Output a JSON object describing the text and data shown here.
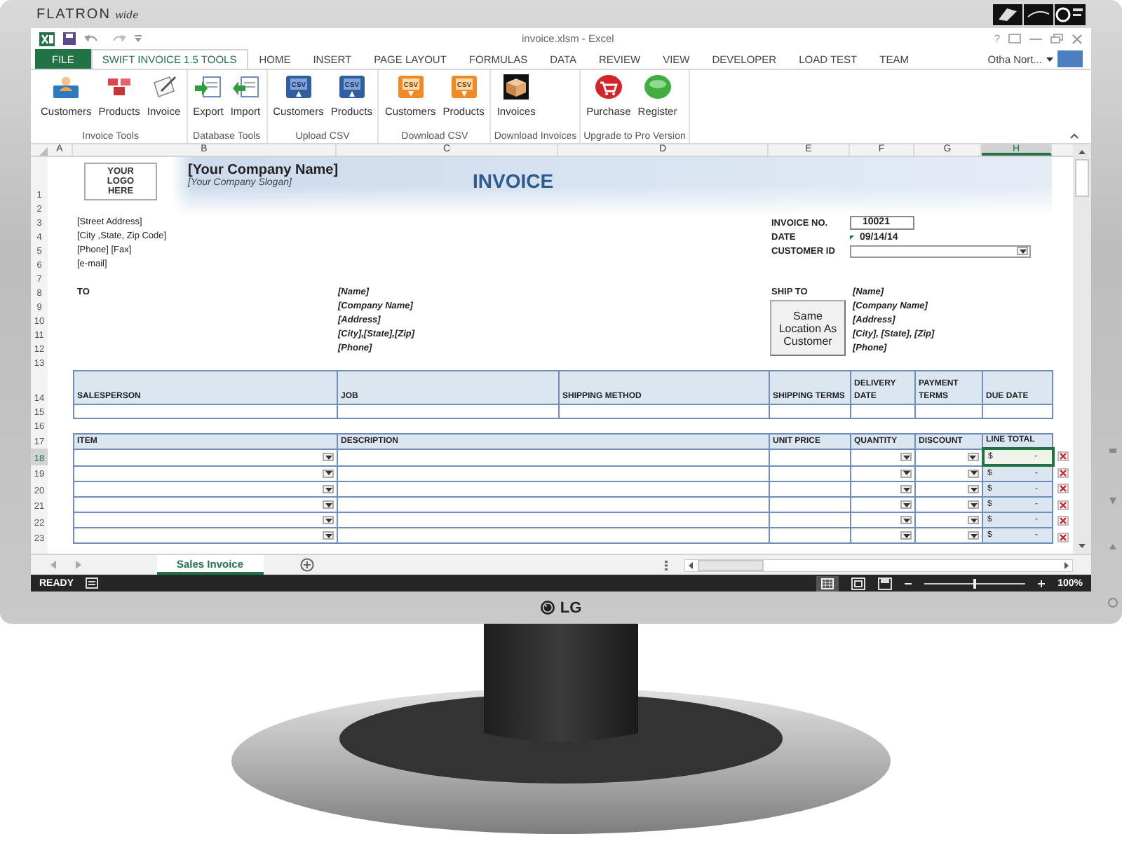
{
  "monitor": {
    "brand": "FLATRON",
    "brand_suffix": "wide",
    "logo": "LG"
  },
  "window": {
    "title": "invoice.xlsm - Excel",
    "help": "?"
  },
  "tabs": [
    {
      "label": "FILE",
      "kind": "file",
      "selected": false
    },
    {
      "label": "SWIFT INVOICE 1.5 TOOLS",
      "kind": "tab",
      "selected": true
    },
    {
      "label": "HOME",
      "kind": "tab",
      "selected": false
    },
    {
      "label": "INSERT",
      "kind": "tab",
      "selected": false
    },
    {
      "label": "PAGE LAYOUT",
      "kind": "tab",
      "selected": false
    },
    {
      "label": "FORMULAS",
      "kind": "tab",
      "selected": false
    },
    {
      "label": "DATA",
      "kind": "tab",
      "selected": false
    },
    {
      "label": "REVIEW",
      "kind": "tab",
      "selected": false
    },
    {
      "label": "VIEW",
      "kind": "tab",
      "selected": false
    },
    {
      "label": "DEVELOPER",
      "kind": "tab",
      "selected": false
    },
    {
      "label": "LOAD TEST",
      "kind": "tab",
      "selected": false
    },
    {
      "label": "TEAM",
      "kind": "tab",
      "selected": false
    }
  ],
  "account": {
    "name": "Otha Nort..."
  },
  "ribbon_groups": [
    {
      "label": "Invoice Tools",
      "buttons": [
        {
          "label": "Customers",
          "kind": "customers"
        },
        {
          "label": "Products",
          "kind": "products"
        },
        {
          "label": "Invoice",
          "kind": "invoice"
        }
      ]
    },
    {
      "label": "Database Tools",
      "buttons": [
        {
          "label": "Export",
          "kind": "export"
        },
        {
          "label": "Import",
          "kind": "import"
        }
      ]
    },
    {
      "label": "Upload CSV",
      "buttons": [
        {
          "label": "Customers",
          "kind": "csv-upload",
          "icon_text": "CSV"
        },
        {
          "label": "Products",
          "kind": "csv-upload",
          "icon_text": "CSV"
        }
      ]
    },
    {
      "label": "Download CSV",
      "buttons": [
        {
          "label": "Customers",
          "kind": "csv-download",
          "icon_text": "CSV"
        },
        {
          "label": "Products",
          "kind": "csv-download",
          "icon_text": "CSV"
        }
      ]
    },
    {
      "label": "Download Invoices",
      "buttons": [
        {
          "label": "Invoices",
          "kind": "box"
        }
      ]
    },
    {
      "label": "Upgrade to Pro Version",
      "buttons": [
        {
          "label": "Purchase",
          "kind": "purchase"
        },
        {
          "label": "Register",
          "kind": "register"
        }
      ]
    }
  ],
  "columns": [
    {
      "label": "A",
      "selected": false
    },
    {
      "label": "B",
      "selected": false
    },
    {
      "label": "C",
      "selected": false
    },
    {
      "label": "D",
      "selected": false
    },
    {
      "label": "E",
      "selected": false
    },
    {
      "label": "F",
      "selected": false
    },
    {
      "label": "G",
      "selected": false
    },
    {
      "label": "H",
      "selected": true
    }
  ],
  "rows": [
    {
      "label": "1",
      "selected": false
    },
    {
      "label": "2",
      "selected": false
    },
    {
      "label": "3",
      "selected": false
    },
    {
      "label": "4",
      "selected": false
    },
    {
      "label": "5",
      "selected": false
    },
    {
      "label": "6",
      "selected": false
    },
    {
      "label": "7",
      "selected": false
    },
    {
      "label": "8",
      "selected": false
    },
    {
      "label": "9",
      "selected": false
    },
    {
      "label": "10",
      "selected": false
    },
    {
      "label": "11",
      "selected": false
    },
    {
      "label": "12",
      "selected": false
    },
    {
      "label": "13",
      "selected": false
    },
    {
      "label": "14",
      "selected": false
    },
    {
      "label": "15",
      "selected": false
    },
    {
      "label": "16",
      "selected": false
    },
    {
      "label": "17",
      "selected": false
    },
    {
      "label": "18",
      "selected": true
    },
    {
      "label": "19",
      "selected": false
    },
    {
      "label": "20",
      "selected": false
    },
    {
      "label": "21",
      "selected": false
    },
    {
      "label": "22",
      "selected": false
    },
    {
      "label": "23",
      "selected": false
    }
  ],
  "header": {
    "logo_text": "YOUR LOGO HERE",
    "company_name": "[Your Company Name]",
    "slogan": "[Your Company Slogan]",
    "title": "INVOICE"
  },
  "from_address": [
    "[Street Address]",
    "[City ,State, Zip Code]",
    "[Phone] [Fax]",
    "[e-mail]"
  ],
  "to": {
    "label": "TO",
    "lines": [
      "[Name]",
      "[Company Name]",
      "[Address]",
      "[City],[State],[Zip]",
      "[Phone]"
    ]
  },
  "invoice_info": {
    "invoice_no_label": "INVOICE NO.",
    "invoice_no": "10021",
    "date_label": "DATE",
    "date": "09/14/14",
    "customer_id_label": "CUSTOMER ID"
  },
  "ship_to": {
    "label": "SHIP TO",
    "button": "Same Location As Customer",
    "lines": [
      "[Name]",
      "[Company Name]",
      "[Address]",
      "[City], [State], [Zip]",
      "[Phone]"
    ]
  },
  "order_table": {
    "columns": [
      "SALESPERSON",
      "JOB",
      "SHIPPING METHOD",
      "SHIPPING TERMS",
      "DELIVERY DATE",
      "PAYMENT TERMS",
      "DUE DATE"
    ]
  },
  "items_table": {
    "columns": [
      "ITEM",
      "DESCRIPTION",
      "UNIT PRICE",
      "QUANTITY",
      "DISCOUNT",
      "LINE TOTAL"
    ],
    "rows": [
      {
        "currency": "$",
        "amount": "-",
        "selected": true
      },
      {
        "currency": "$",
        "amount": "-",
        "selected": false
      },
      {
        "currency": "$",
        "amount": "-",
        "selected": false
      },
      {
        "currency": "$",
        "amount": "-",
        "selected": false
      },
      {
        "currency": "$",
        "amount": "-",
        "selected": false
      },
      {
        "currency": "$",
        "amount": "-",
        "selected": false
      }
    ]
  },
  "sheet_tabs": [
    {
      "label": "Sales Invoice",
      "selected": true
    }
  ],
  "status_bar": {
    "text": "READY",
    "zoom": "100%",
    "zoom_slider": {
      "level": 0.5
    }
  }
}
